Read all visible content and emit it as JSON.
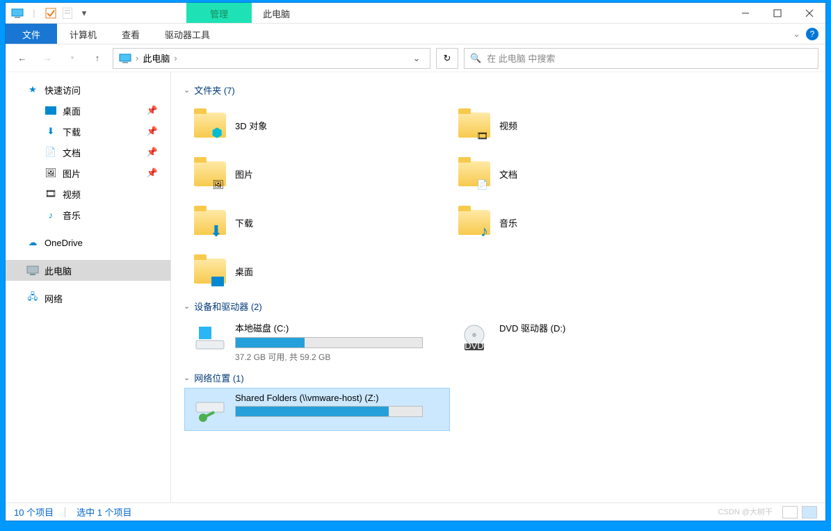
{
  "titlebar": {
    "manage_tab": "管理",
    "title": "此电脑"
  },
  "menubar": {
    "file": "文件",
    "computer": "计算机",
    "view": "查看",
    "drive_tools": "驱动器工具"
  },
  "navbar": {
    "breadcrumb_root": "此电脑",
    "breadcrumb_sep": "›",
    "search_placeholder": "在 此电脑 中搜索"
  },
  "sidebar": {
    "quick_access": "快速访问",
    "pinned": [
      {
        "label": "桌面"
      },
      {
        "label": "下载"
      },
      {
        "label": "文档"
      },
      {
        "label": "图片"
      }
    ],
    "video": "视频",
    "music": "音乐",
    "onedrive": "OneDrive",
    "this_pc": "此电脑",
    "network": "网络"
  },
  "sections": {
    "folders_header": "文件夹 (7)",
    "folders": [
      {
        "label": "3D 对象"
      },
      {
        "label": "视频"
      },
      {
        "label": "图片"
      },
      {
        "label": "文档"
      },
      {
        "label": "下载"
      },
      {
        "label": "音乐"
      },
      {
        "label": "桌面"
      }
    ],
    "drives_header": "设备和驱动器 (2)",
    "drives": [
      {
        "label": "本地磁盘 (C:)",
        "free_text": "37.2 GB 可用,  共 59.2 GB",
        "fill_pct": 37
      },
      {
        "label": "DVD 驱动器 (D:)"
      }
    ],
    "network_header": "网络位置 (1)",
    "network_drives": [
      {
        "label": "Shared Folders (\\\\vmware-host) (Z:)",
        "fill_pct": 82
      }
    ]
  },
  "statusbar": {
    "item_count": "10 个项目",
    "selection": "选中 1 个项目",
    "watermark": "CSDN @大树干"
  }
}
